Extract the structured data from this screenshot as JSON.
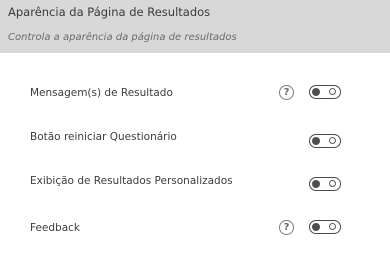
{
  "header": {
    "title": "Aparência da Página de Resultados",
    "subtitle": "Controla a aparência da página de resultados"
  },
  "settings": [
    {
      "label": "Mensagem(s) de Resultado",
      "has_help": true,
      "enabled": false
    },
    {
      "label": "Botão reiniciar Questionário",
      "has_help": false,
      "enabled": false
    },
    {
      "label": "Exibição de Resultados Personalizados",
      "has_help": false,
      "enabled": false
    },
    {
      "label": "Feedback",
      "has_help": true,
      "enabled": false
    }
  ],
  "help_icon_glyph": "?"
}
